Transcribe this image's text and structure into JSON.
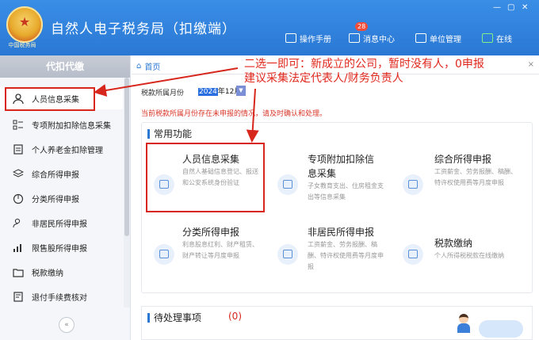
{
  "app": {
    "title": "自然人电子税务局（扣缴端）",
    "emblem_text": "中国税务局"
  },
  "window_controls": {
    "min": "—",
    "max": "▢",
    "close": "✕"
  },
  "toolbar": {
    "manual": "操作手册",
    "messages": "消息中心",
    "messages_badge": "28",
    "unit_mgmt": "单位管理",
    "online": "在线"
  },
  "sidebar": {
    "header": "代扣代缴",
    "collapse": "«",
    "items": [
      {
        "label": "人员信息采集",
        "icon": "person-icon"
      },
      {
        "label": "专项附加扣除信息采集",
        "icon": "list-icon"
      },
      {
        "label": "个人养老金扣除管理",
        "icon": "document-icon"
      },
      {
        "label": "综合所得申报",
        "icon": "layers-icon"
      },
      {
        "label": "分类所得申报",
        "icon": "pie-chart-icon"
      },
      {
        "label": "非居民所得申报",
        "icon": "person-outline-icon"
      },
      {
        "label": "限售股所得申报",
        "icon": "bar-chart-icon"
      },
      {
        "label": "税款缴纳",
        "icon": "folder-icon"
      },
      {
        "label": "退付手续费核对",
        "icon": "receipt-icon"
      }
    ]
  },
  "tabs": {
    "home": "首页",
    "close": "×"
  },
  "period": {
    "label": "税款所属月份",
    "year": "2024",
    "rest": "年12月"
  },
  "notice": "当前税款所属月份存在未申报的情况，请及时确认和处理。",
  "common": {
    "title": "常用功能",
    "cards": [
      {
        "title": "人员信息采集",
        "desc": "自然人基础信息登记、报送和公安系统身份验证"
      },
      {
        "title_line1": "专项附加扣除信",
        "title_line2": "息采集",
        "desc": "子女教育支出、住房租金支出等信息采集"
      },
      {
        "title": "综合所得申报",
        "desc": "工资薪金、劳务报酬、稿酬、特许权使用费等月度申报"
      },
      {
        "title": "分类所得申报",
        "desc": "利息股息红利、财产租赁、财产转让等月度申报"
      },
      {
        "title": "非居民所得申报",
        "desc": "工资薪金、劳务报酬、稿酬、特许权使用费等月度申报"
      },
      {
        "title": "税款缴纳",
        "desc": "个人所得税税款在线缴纳"
      }
    ]
  },
  "pending": {
    "title": "待处理事项",
    "count": "(0)"
  },
  "annotation": {
    "line1": "二选一即可：新成立的公司，暂时没有人，0申报",
    "line2": "建议采集法定代表人/财务负责人"
  },
  "colors": {
    "brand": "#2a78d4",
    "highlight": "#d7261c"
  }
}
